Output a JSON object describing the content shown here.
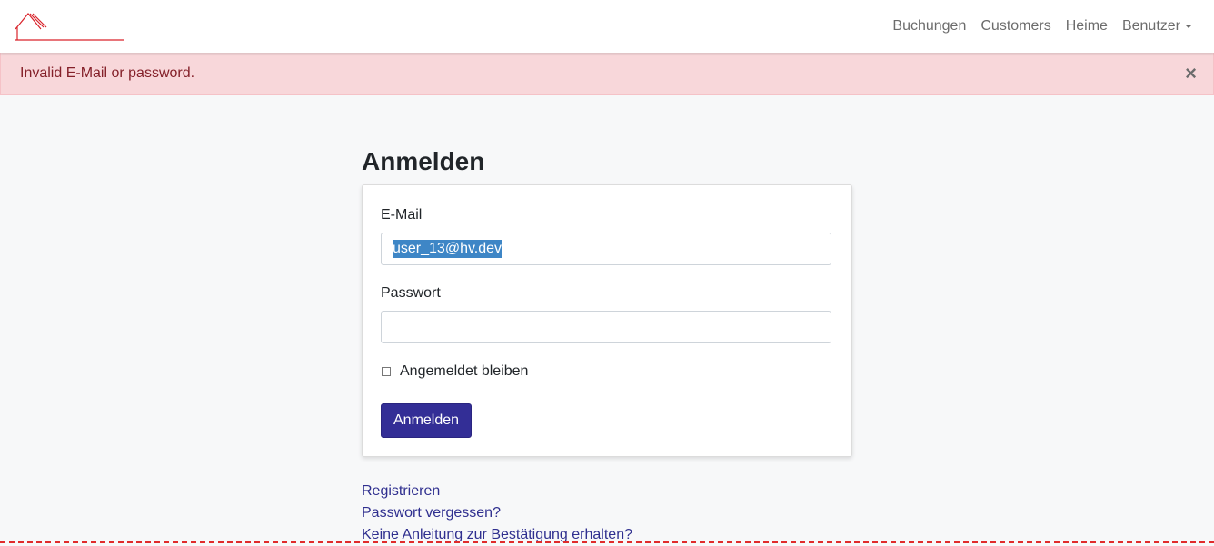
{
  "nav": {
    "items": [
      "Buchungen",
      "Customers",
      "Heime"
    ],
    "dropdown_label": "Benutzer"
  },
  "alert": {
    "message": "Invalid E-Mail or password.",
    "close": "×"
  },
  "login": {
    "title": "Anmelden",
    "email_label": "E-Mail",
    "email_value": "user_13@hv.dev",
    "password_label": "Passwort",
    "password_value": "",
    "remember_label": "Angemeldet bleiben",
    "remember_checked": false,
    "submit_label": "Anmelden"
  },
  "links": {
    "register": "Registrieren",
    "forgot_password": "Passwort vergessen?",
    "no_confirmation": "Keine Anleitung zur Bestätigung erhalten?"
  },
  "colors": {
    "brand_red": "#d9232a",
    "alert_bg": "#f8d7da",
    "alert_text": "#842029",
    "primary_button": "#332e96",
    "link": "#2f2f8f"
  },
  "icons": {
    "logo": "house-logo-icon",
    "close": "close-icon",
    "dropdown": "caret-down-icon"
  }
}
